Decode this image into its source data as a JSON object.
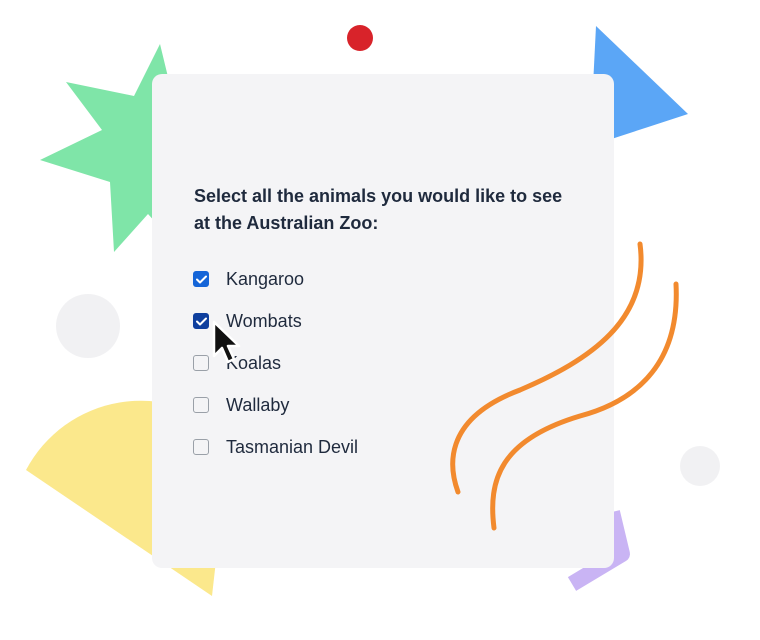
{
  "form": {
    "question": "Select all the animals you would like to see at the Australian Zoo:",
    "options": [
      {
        "label": "Kangaroo",
        "checked": true
      },
      {
        "label": "Wombats",
        "checked": true
      },
      {
        "label": "Koalas",
        "checked": false
      },
      {
        "label": "Wallaby",
        "checked": false
      },
      {
        "label": "Tasmanian Devil",
        "checked": false
      }
    ]
  },
  "colors": {
    "checkbox_checked": "#1565d8",
    "checkbox_focused": "#0f3f9e",
    "text": "#1f2a3d",
    "card": "#f4f4f6"
  },
  "icons": [
    "check-icon",
    "mouse-pointer-icon"
  ]
}
